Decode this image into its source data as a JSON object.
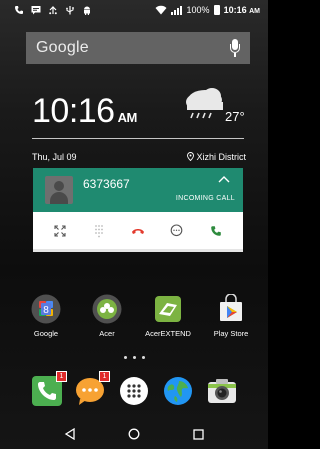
{
  "status_bar": {
    "battery_percent": "100%",
    "time": "10:16",
    "ampm": "AM",
    "left_icons": [
      "phone-icon",
      "message-icon",
      "alarm-icon",
      "usb-icon",
      "android-icon"
    ],
    "right_icons": [
      "wifi-icon",
      "signal-icon",
      "battery-icon"
    ]
  },
  "search": {
    "logo_text": "Google"
  },
  "clock_widget": {
    "time": "10:16",
    "ampm": "AM",
    "temperature": "27°",
    "date": "Thu, Jul 09",
    "location": "Xizhi District"
  },
  "call": {
    "number": "6373667",
    "status": "INCOMING CALL",
    "actions": [
      "expand-icon",
      "dialpad-icon",
      "hangup-icon",
      "message-icon",
      "answer-icon"
    ]
  },
  "apps": [
    {
      "label": "Google"
    },
    {
      "label": "Acer"
    },
    {
      "label": "AcerEXTEND"
    },
    {
      "label": "Play Store"
    }
  ],
  "dock": {
    "phone_badge": "1",
    "messages_badge": "1"
  },
  "colors": {
    "call_green": "#1f8a70",
    "hangup_red": "#e33b2e",
    "answer_green": "#2e8b3e",
    "badge_red": "#e02b2b"
  }
}
